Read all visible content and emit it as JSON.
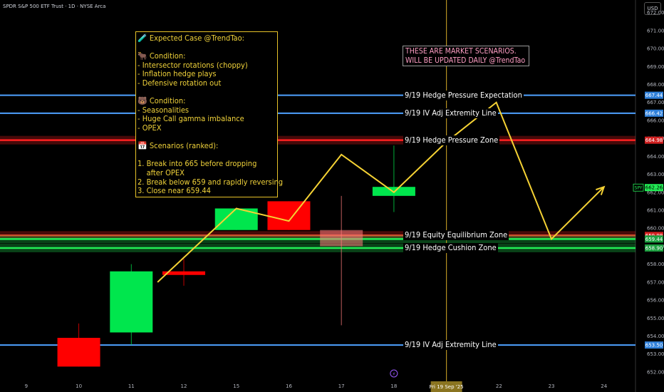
{
  "header": {
    "title": "SPDR S&P 500 ETF Trust · 1D · NYSE Arca",
    "currency": "USD"
  },
  "annotations": {
    "case_title": "Expected Case @TrendTao:",
    "bull_condition_title": "Condition:",
    "bull_conditions": [
      "- Intersector rotations (choppy)",
      "- Inflation hedge plays",
      "- Defensive rotation out"
    ],
    "bear_condition_title": "Condition:",
    "bear_conditions": [
      "- Seasonalities",
      "- Huge Call gamma imbalance",
      "- OPEX"
    ],
    "scenarios_title": "Scenarios (ranked):",
    "scenarios": [
      "1. Break into 665 before dropping",
      "    after OPEX",
      "2. Break below 659 and rapidly reversing",
      "3. Close near 659.44"
    ],
    "banner_line1": "THESE ARE MARKET SCENARIOS.",
    "banner_line2": "WILL BE UPDATED DAILY @TrendTao",
    "icons": {
      "case": "test-tube-icon",
      "bull": "ox-icon",
      "bear": "bear-icon",
      "scenarios": "calendar-icon",
      "event": "lightning-icon"
    }
  },
  "chart_data": {
    "type": "candlestick",
    "y_range": [
      651.6,
      672.7
    ],
    "y_ticks": [
      "672.00",
      "671.00",
      "670.00",
      "669.00",
      "668.00",
      "667.00",
      "666.00",
      "665.00",
      "664.00",
      "663.00",
      "662.00",
      "661.00",
      "660.00",
      "659.00",
      "658.00",
      "657.00",
      "656.00",
      "655.00",
      "654.00",
      "653.00",
      "652.00"
    ],
    "x_ticks": [
      "9",
      "10",
      "11",
      "12",
      "15",
      "16",
      "17",
      "18",
      "Fri 19 Sep '25",
      "22",
      "23",
      "24"
    ],
    "x_tick_pos": [
      1,
      2,
      3,
      4,
      5,
      6,
      7,
      8,
      9,
      10,
      11,
      12
    ],
    "x_range": [
      0.5,
      12.6
    ],
    "current_label": "Fri 19 Sep '25",
    "candles": [
      {
        "x": 2,
        "open": 653.9,
        "close": 652.3,
        "high": 654.7,
        "low": 652.3,
        "color": "#ff0000"
      },
      {
        "x": 3,
        "open": 654.2,
        "close": 657.6,
        "high": 658.0,
        "low": 653.5,
        "color": "#00e64d"
      },
      {
        "x": 4,
        "open": 657.6,
        "close": 657.4,
        "high": 658.3,
        "low": 656.8,
        "color": "#ff0000"
      },
      {
        "x": 5,
        "open": 659.9,
        "close": 661.1,
        "high": 661.1,
        "low": 659.9,
        "color": "#00e64d"
      },
      {
        "x": 6,
        "open": 661.5,
        "close": 659.9,
        "high": 661.5,
        "low": 659.9,
        "color": "#ff0000"
      },
      {
        "x": 7,
        "open": 659.9,
        "close": 659.0,
        "high": 661.8,
        "low": 654.6,
        "color": "#ff7b7b"
      },
      {
        "x": 8,
        "open": 661.8,
        "close": 662.3,
        "high": 664.6,
        "low": 660.9,
        "color": "#00e64d"
      }
    ],
    "levels": [
      {
        "name": "9/19 Hedge Pressure Expectation",
        "value": 667.4,
        "color": "#4ea1ff",
        "tag": "667.44",
        "tag_bg": "#2e7fd9"
      },
      {
        "name": "9/19 IV Adj Extremity Line",
        "value": 666.4,
        "color": "#4ea1ff",
        "tag": "666.42",
        "tag_bg": "#2e7fd9"
      },
      {
        "name": "9/19 Hedge Pressure Zone",
        "value": 664.9,
        "color": "#ff2020",
        "tag": "664.98",
        "tag_bg": "#d12020"
      },
      {
        "name": "9/19 Equity Equilibrium Zone",
        "value": 659.6,
        "color": "#ff2020",
        "tag": "659.98",
        "tag_bg": "#d12020"
      },
      {
        "name": "",
        "value": 659.4,
        "color": "#22ee55",
        "tag": "659.44",
        "tag_bg": "#1ca040"
      },
      {
        "name": "9/19 Hedge Cushion Zone",
        "value": 658.9,
        "color": "#22ee55",
        "tag": "658.90",
        "tag_bg": "#1ca040"
      },
      {
        "name": "9/19 IV Adj Extremity Line",
        "value": 653.5,
        "color": "#4ea1ff",
        "tag": "653.50",
        "tag_bg": "#2e7fd9"
      }
    ],
    "price_tag": {
      "label": "SPY",
      "value": 662.26,
      "text": "662.26",
      "color": "#22ee55"
    },
    "scenario_path": [
      [
        3.5,
        657.0
      ],
      [
        5.0,
        661.1
      ],
      [
        6.0,
        660.4
      ],
      [
        7.0,
        664.1
      ],
      [
        8.0,
        662.0
      ],
      [
        9.0,
        664.8
      ],
      [
        9.95,
        667.0
      ],
      [
        11.0,
        659.4
      ],
      [
        12.0,
        662.3
      ]
    ],
    "scenario_color": "#f5d234",
    "current_x": 9.0,
    "grid": false
  }
}
